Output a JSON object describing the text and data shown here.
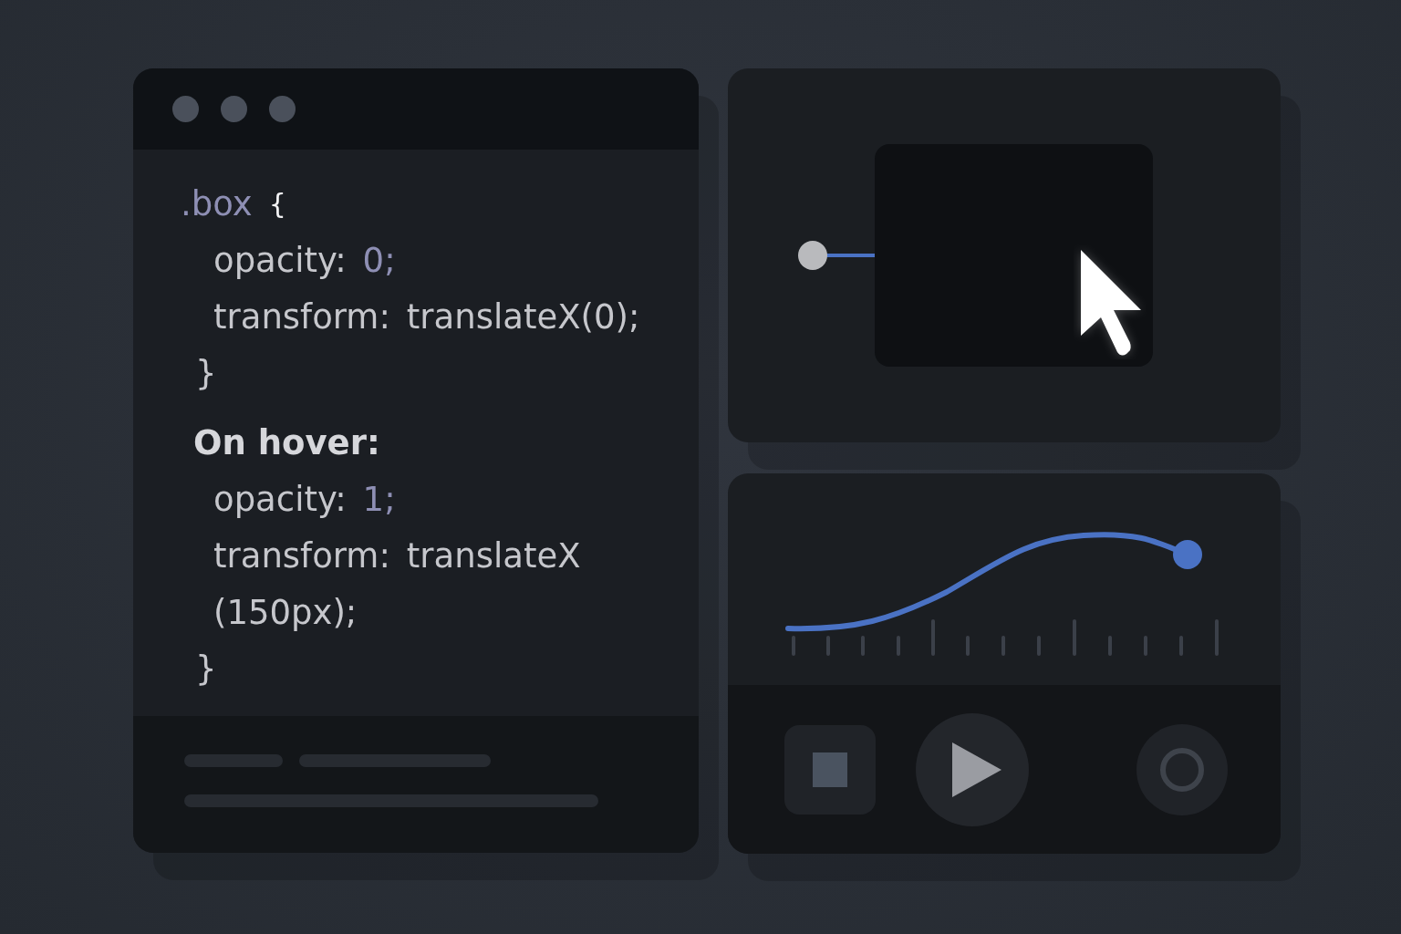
{
  "editor": {
    "code": [
      {
        "kind": "selector",
        "parts": [
          {
            "text": ".box",
            "kind": "name"
          },
          {
            "text": "{",
            "kind": "brace"
          }
        ]
      },
      {
        "kind": "decl",
        "parts": [
          {
            "text": "opacity:",
            "kind": "plain"
          },
          {
            "text": "0;",
            "kind": "value"
          }
        ]
      },
      {
        "kind": "decl",
        "parts": [
          {
            "text": "transform:",
            "kind": "plain"
          },
          {
            "text": "translateX(0);",
            "kind": "plain"
          }
        ]
      },
      {
        "kind": "close",
        "parts": [
          {
            "text": "}",
            "kind": "plain"
          }
        ]
      },
      {
        "kind": "heading",
        "parts": [
          {
            "text": "On hover:",
            "kind": "plain"
          }
        ]
      },
      {
        "kind": "decl",
        "parts": [
          {
            "text": "opacity:",
            "kind": "plain"
          },
          {
            "text": "1;",
            "kind": "value"
          }
        ]
      },
      {
        "kind": "decl",
        "parts": [
          {
            "text": "transform:",
            "kind": "plain"
          },
          {
            "text": "translateX",
            "kind": "plain"
          }
        ]
      },
      {
        "kind": "decl",
        "parts": [
          {
            "text": "(150px);",
            "kind": "plain"
          }
        ]
      },
      {
        "kind": "close",
        "parts": [
          {
            "text": "}",
            "kind": "plain"
          }
        ]
      }
    ]
  },
  "player": {
    "controls": [
      {
        "kind": "stop"
      },
      {
        "kind": "play"
      },
      {
        "kind": "record"
      }
    ]
  }
}
